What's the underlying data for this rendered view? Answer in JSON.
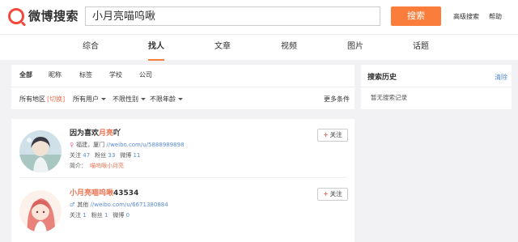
{
  "header": {
    "logo_text": "微博搜索",
    "search_value": "小月亮喵呜啾",
    "search_button": "搜索",
    "advanced_search": "高级搜索",
    "help": "帮助"
  },
  "tabs": [
    "综合",
    "找人",
    "文章",
    "视频",
    "图片",
    "话题"
  ],
  "filters": {
    "types": [
      "全部",
      "昵称",
      "标签",
      "学校",
      "公司"
    ],
    "region_label": "所有地区",
    "region_switch": "[切换]",
    "dropdowns": [
      "所有用户",
      "不限性别",
      "不限年龄"
    ],
    "more": "更多条件"
  },
  "sidebar": {
    "title": "搜索历史",
    "clear": "清除",
    "empty": "暂无搜索记录"
  },
  "results": [
    {
      "name_prefix": "因为喜欢",
      "name_highlight": "月亮",
      "name_suffix": "吖",
      "location": "福建，厦门",
      "url": "//weibo.com/u/5888989898",
      "follow_label": "关注",
      "follow_count": "47",
      "fans_label": "粉丝",
      "fans_count": "33",
      "weibo_label": "微博",
      "weibo_count": "11",
      "intro_label": "简介：",
      "intro_value": "喵呜啾小月亮",
      "button": "关注"
    },
    {
      "name_highlight": "小月亮喵呜啾",
      "name_suffix": "43534",
      "location": "其他",
      "url": "//weibo.com/u/6671380884",
      "follow_label": "关注",
      "follow_count": "1",
      "fans_label": "粉丝",
      "fans_count": "1",
      "weibo_label": "微博",
      "weibo_count": "0",
      "button": "关注"
    }
  ],
  "colors": {
    "accent": "#fa7d3c",
    "highlight": "#eb7350",
    "link": "#5a8ccf"
  }
}
